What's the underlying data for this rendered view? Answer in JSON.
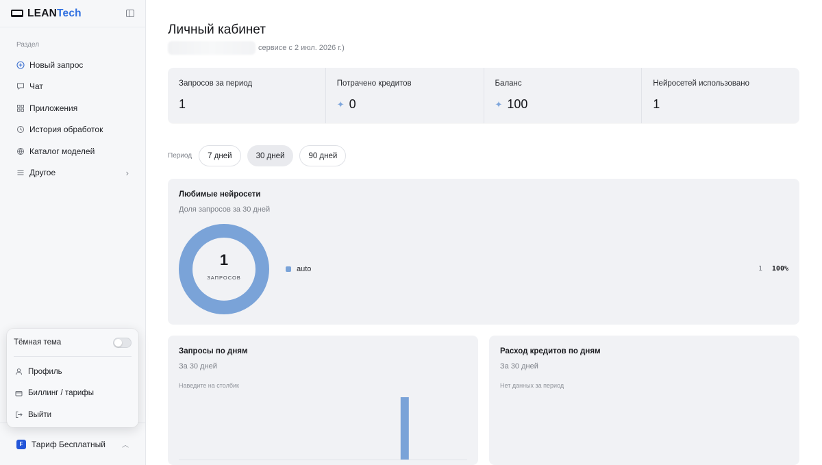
{
  "brand": {
    "name_main": "LEAN",
    "name_accent": "Tech"
  },
  "sidebar": {
    "section_label": "Раздел",
    "items": [
      {
        "label": "Новый запрос",
        "icon": "plus-circle-icon"
      },
      {
        "label": "Чат",
        "icon": "chat-icon"
      },
      {
        "label": "Приложения",
        "icon": "grid-icon"
      },
      {
        "label": "История обработок",
        "icon": "history-icon"
      },
      {
        "label": "Каталог моделей",
        "icon": "globe-icon"
      },
      {
        "label": "Другое",
        "icon": "menu-icon"
      }
    ],
    "plan": {
      "badge": "F",
      "label": "Тариф Бесплатный"
    }
  },
  "popup": {
    "dark_theme_label": "Тёмная тема",
    "dark_theme_enabled": false,
    "items": [
      {
        "label": "Профиль",
        "icon": "user-icon"
      },
      {
        "label": "Биллинг / тарифы",
        "icon": "card-icon"
      },
      {
        "label": "Выйти",
        "icon": "logout-icon"
      }
    ]
  },
  "main": {
    "title": "Личный кабинет",
    "subtitle": "сервисе с 2 июл. 2026 г.)",
    "stats": [
      {
        "label": "Запросов за период",
        "value": "1",
        "spark": false
      },
      {
        "label": "Потрачено кредитов",
        "value": "0",
        "spark": true
      },
      {
        "label": "Баланс",
        "value": "100",
        "spark": true
      },
      {
        "label": "Нейросетей использовано",
        "value": "1",
        "spark": false
      }
    ],
    "period": {
      "label": "Период",
      "options": [
        "7 дней",
        "30 дней",
        "90 дней"
      ],
      "selected": "30 дней"
    },
    "favorites": {
      "title": "Любимые нейросети",
      "subtitle": "Доля запросов за 30 дней",
      "total": "1",
      "total_caption": "ЗАПРОСОВ",
      "legend": [
        {
          "name": "auto",
          "count": "1",
          "percent": "100%"
        }
      ]
    },
    "requests_by_day": {
      "title": "Запросы по дням",
      "subtitle": "За 30 дней",
      "hint": "Наведите на столбик"
    },
    "credits_by_day": {
      "title": "Расход кредитов по дням",
      "subtitle": "За 30 дней",
      "hint": "Нет данных за период"
    }
  },
  "colors": {
    "accent": "#2f6fe0",
    "chart": "#7aa3d8",
    "plan_badge": "#2356d9"
  },
  "chart_data": [
    {
      "type": "pie",
      "title": "Любимые нейросети",
      "categories": [
        "auto"
      ],
      "values": [
        1
      ]
    },
    {
      "type": "bar",
      "title": "Запросы по дням",
      "days": 30,
      "values": [
        0,
        0,
        0,
        0,
        0,
        0,
        0,
        0,
        0,
        0,
        0,
        0,
        0,
        0,
        0,
        0,
        0,
        0,
        0,
        0,
        0,
        0,
        0,
        1,
        0,
        0,
        0,
        0,
        0,
        0
      ]
    }
  ]
}
